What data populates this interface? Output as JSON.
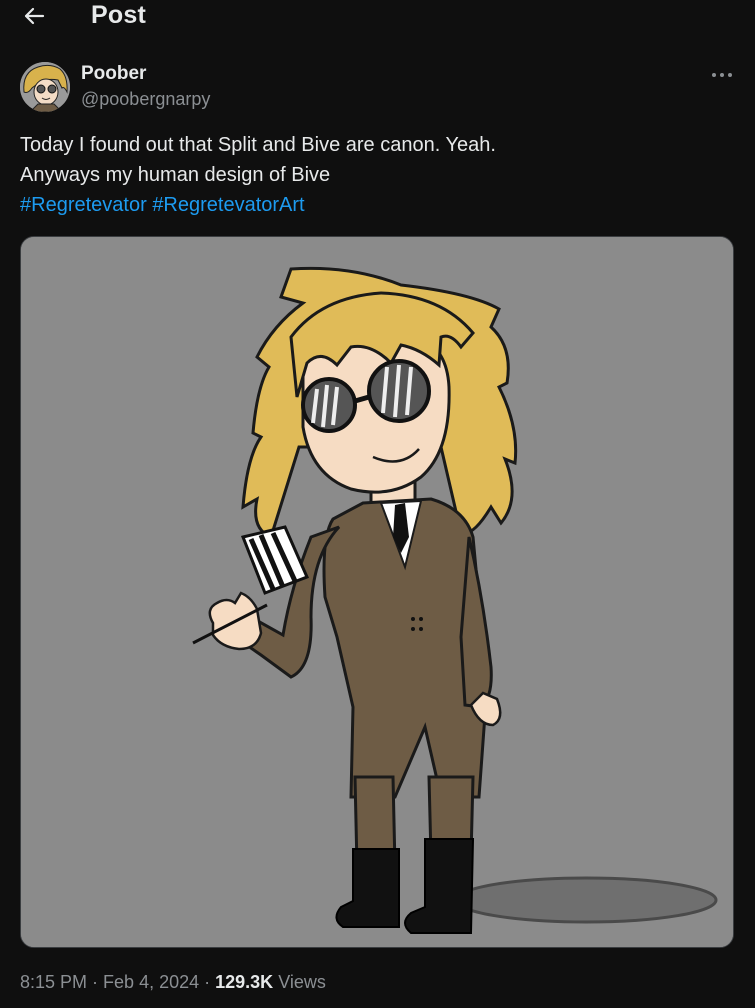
{
  "header": {
    "back_icon": "arrow-left-icon",
    "title": "Post"
  },
  "author": {
    "display_name": "Poober",
    "handle": "@poobergnarpy",
    "more_icon": "more-horizontal-icon"
  },
  "post": {
    "lines": [
      "Today I found out that Split and Bive are canon. Yeah.",
      "Anyways my human design of Bive"
    ],
    "hashtags": [
      "#Regretevator",
      "#RegretevatorArt"
    ]
  },
  "meta": {
    "time": "8:15 PM",
    "separator": "·",
    "date": "Feb 4, 2024",
    "views_count": "129.3K",
    "views_label": "Views"
  },
  "colors": {
    "background": "#0f0f0f",
    "text": "#e7e9ea",
    "muted": "#8b8f93",
    "link": "#1d9bf0"
  }
}
